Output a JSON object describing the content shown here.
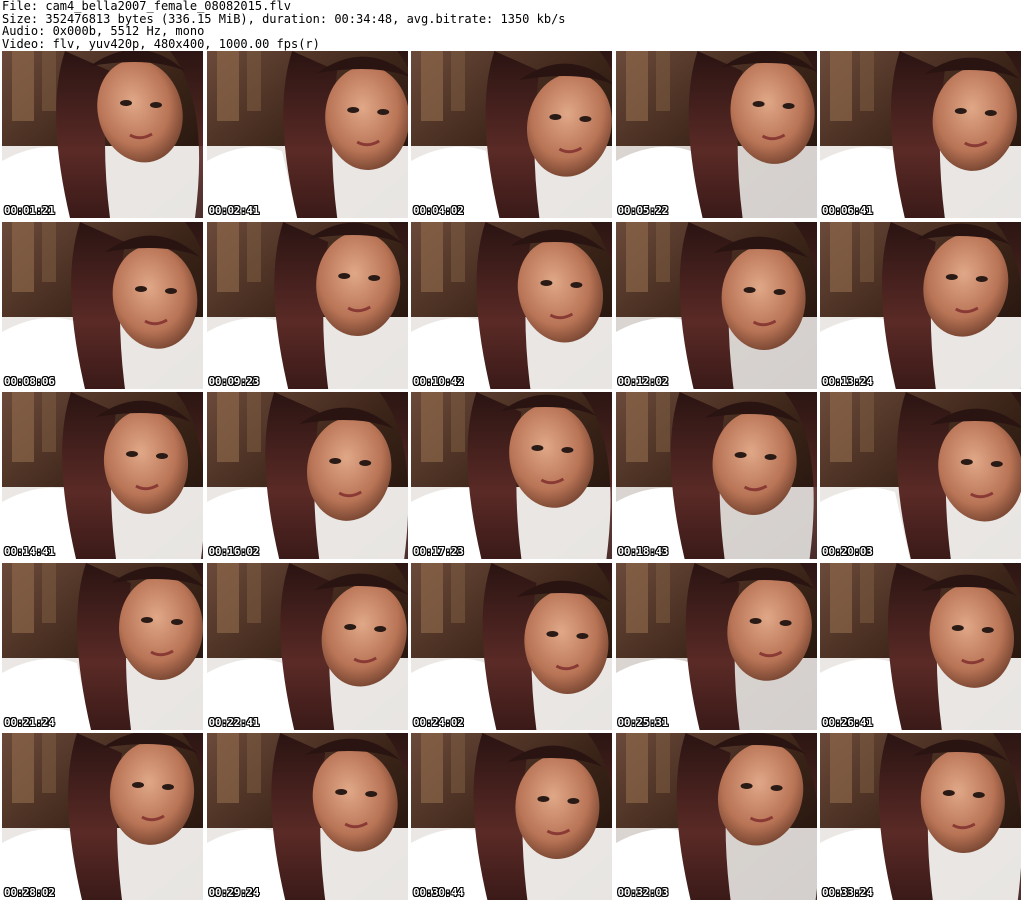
{
  "header": {
    "line1": "File: cam4_bella2007_female_08082015.flv",
    "line2": "Size: 352476813 bytes (336.15 MiB), duration: 00:34:48, avg.bitrate: 1350 kb/s",
    "line3": "Audio: 0x000b, 5512 Hz, mono",
    "line4": "Video: flv, yuv420p, 480x400, 1000.00 fps(r)"
  },
  "thumbnails": [
    {
      "timestamp": "00:01:21"
    },
    {
      "timestamp": "00:02:41"
    },
    {
      "timestamp": "00:04:02"
    },
    {
      "timestamp": "00:05:22"
    },
    {
      "timestamp": "00:06:41"
    },
    {
      "timestamp": "00:08:06"
    },
    {
      "timestamp": "00:09:23"
    },
    {
      "timestamp": "00:10:42"
    },
    {
      "timestamp": "00:12:02"
    },
    {
      "timestamp": "00:13:24"
    },
    {
      "timestamp": "00:14:41"
    },
    {
      "timestamp": "00:16:02"
    },
    {
      "timestamp": "00:17:23"
    },
    {
      "timestamp": "00:18:43"
    },
    {
      "timestamp": "00:20:03"
    },
    {
      "timestamp": "00:21:24"
    },
    {
      "timestamp": "00:22:41"
    },
    {
      "timestamp": "00:24:02"
    },
    {
      "timestamp": "00:25:31"
    },
    {
      "timestamp": "00:26:41"
    },
    {
      "timestamp": "00:28:02"
    },
    {
      "timestamp": "00:29:24"
    },
    {
      "timestamp": "00:30:44"
    },
    {
      "timestamp": "00:32:03"
    },
    {
      "timestamp": "00:33:24"
    }
  ]
}
